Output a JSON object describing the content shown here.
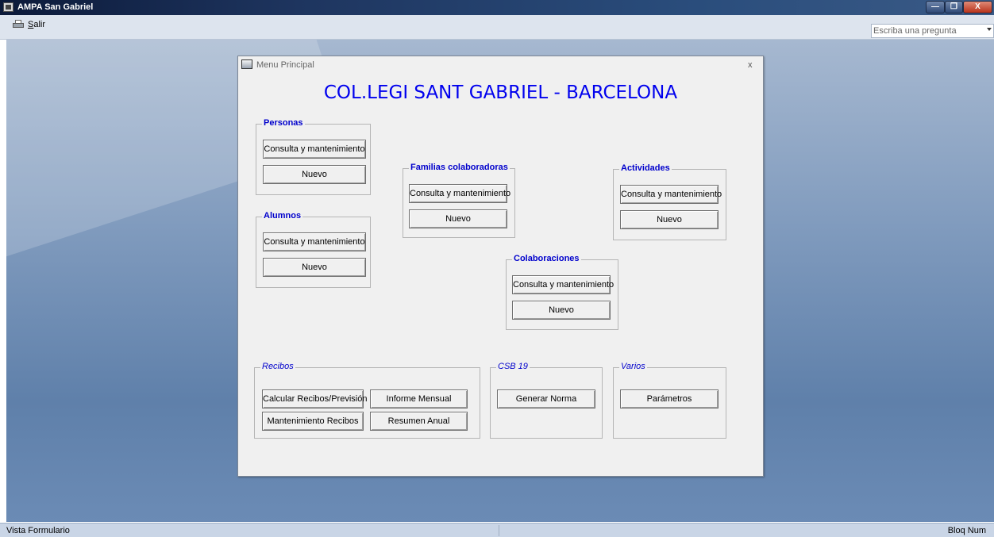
{
  "titlebar": {
    "title": "AMPA San Gabriel",
    "minimize": "—",
    "maximize": "❐",
    "close": "X"
  },
  "menubar": {
    "salir_label": "Salir",
    "help_placeholder": "Escriba una pregunta"
  },
  "form": {
    "title": "Menu Principal",
    "close": "x",
    "heading": "COL.LEGI SANT GABRIEL - BARCELONA",
    "groups": {
      "personas": {
        "label": "Personas",
        "consulta": "Consulta y mantenimiento",
        "nuevo": "Nuevo"
      },
      "alumnos": {
        "label": "Alumnos",
        "consulta": "Consulta y mantenimiento",
        "nuevo": "Nuevo"
      },
      "familias": {
        "label": "Familias colaboradoras",
        "consulta": "Consulta y mantenimiento",
        "nuevo": "Nuevo"
      },
      "actividades": {
        "label": "Actividades",
        "consulta": "Consulta y mantenimiento",
        "nuevo": "Nuevo"
      },
      "colaboraciones": {
        "label": "Colaboraciones",
        "consulta": "Consulta y mantenimiento",
        "nuevo": "Nuevo"
      },
      "recibos": {
        "label": "Recibos",
        "calcular": "Calcular Recibos/Previsión",
        "informe": "Informe Mensual",
        "mantenimiento": "Mantenimiento Recibos",
        "resumen": "Resumen Anual"
      },
      "csb19": {
        "label": "CSB 19",
        "generar": "Generar Norma"
      },
      "varios": {
        "label": "Varios",
        "parametros": "Parámetros"
      }
    }
  },
  "statusbar": {
    "left": "Vista Formulario",
    "right": "Bloq Num"
  }
}
